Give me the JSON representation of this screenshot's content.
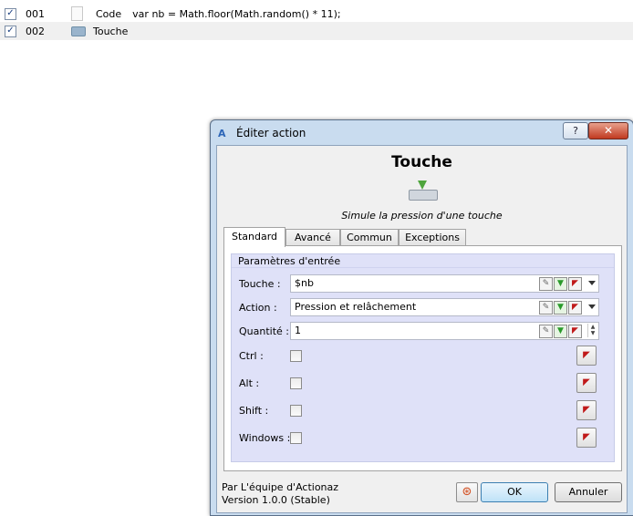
{
  "actions": [
    {
      "checked": true,
      "number": "001",
      "icon": "code-icon",
      "name": "Code",
      "code": "var nb = Math.floor(Math.random() * 11);"
    },
    {
      "checked": true,
      "number": "002",
      "icon": "keyboard-icon",
      "name": "Touche",
      "code": ""
    }
  ],
  "dialog": {
    "title": "Éditer action",
    "help_label": "?",
    "close_label": "✕",
    "action_title": "Touche",
    "description": "Simule la pression d'une touche",
    "tabs": [
      "Standard",
      "Avancé",
      "Commun",
      "Exceptions"
    ],
    "active_tab": "Standard",
    "group_title": "Paramètres d'entrée",
    "fields": {
      "key": {
        "label": "Touche :",
        "value": "$nb"
      },
      "action": {
        "label": "Action :",
        "value": "Pression et relâchement"
      },
      "quantity": {
        "label": "Quantité :",
        "value": "1"
      }
    },
    "modifiers": [
      {
        "label": "Ctrl :",
        "checked": false
      },
      {
        "label": "Alt :",
        "checked": false
      },
      {
        "label": "Shift :",
        "checked": false
      },
      {
        "label": "Windows :",
        "checked": false
      }
    ],
    "footer": {
      "author": "Par L'équipe d'Actionaz",
      "version": "Version 1.0.0 (Stable)",
      "ok_label": "OK",
      "cancel_label": "Annuler"
    }
  },
  "colors": {
    "accent": "#3c7fb1",
    "group_bg": "#dfe1f8",
    "frame": "#c9dcef",
    "close": "#c0391f"
  }
}
